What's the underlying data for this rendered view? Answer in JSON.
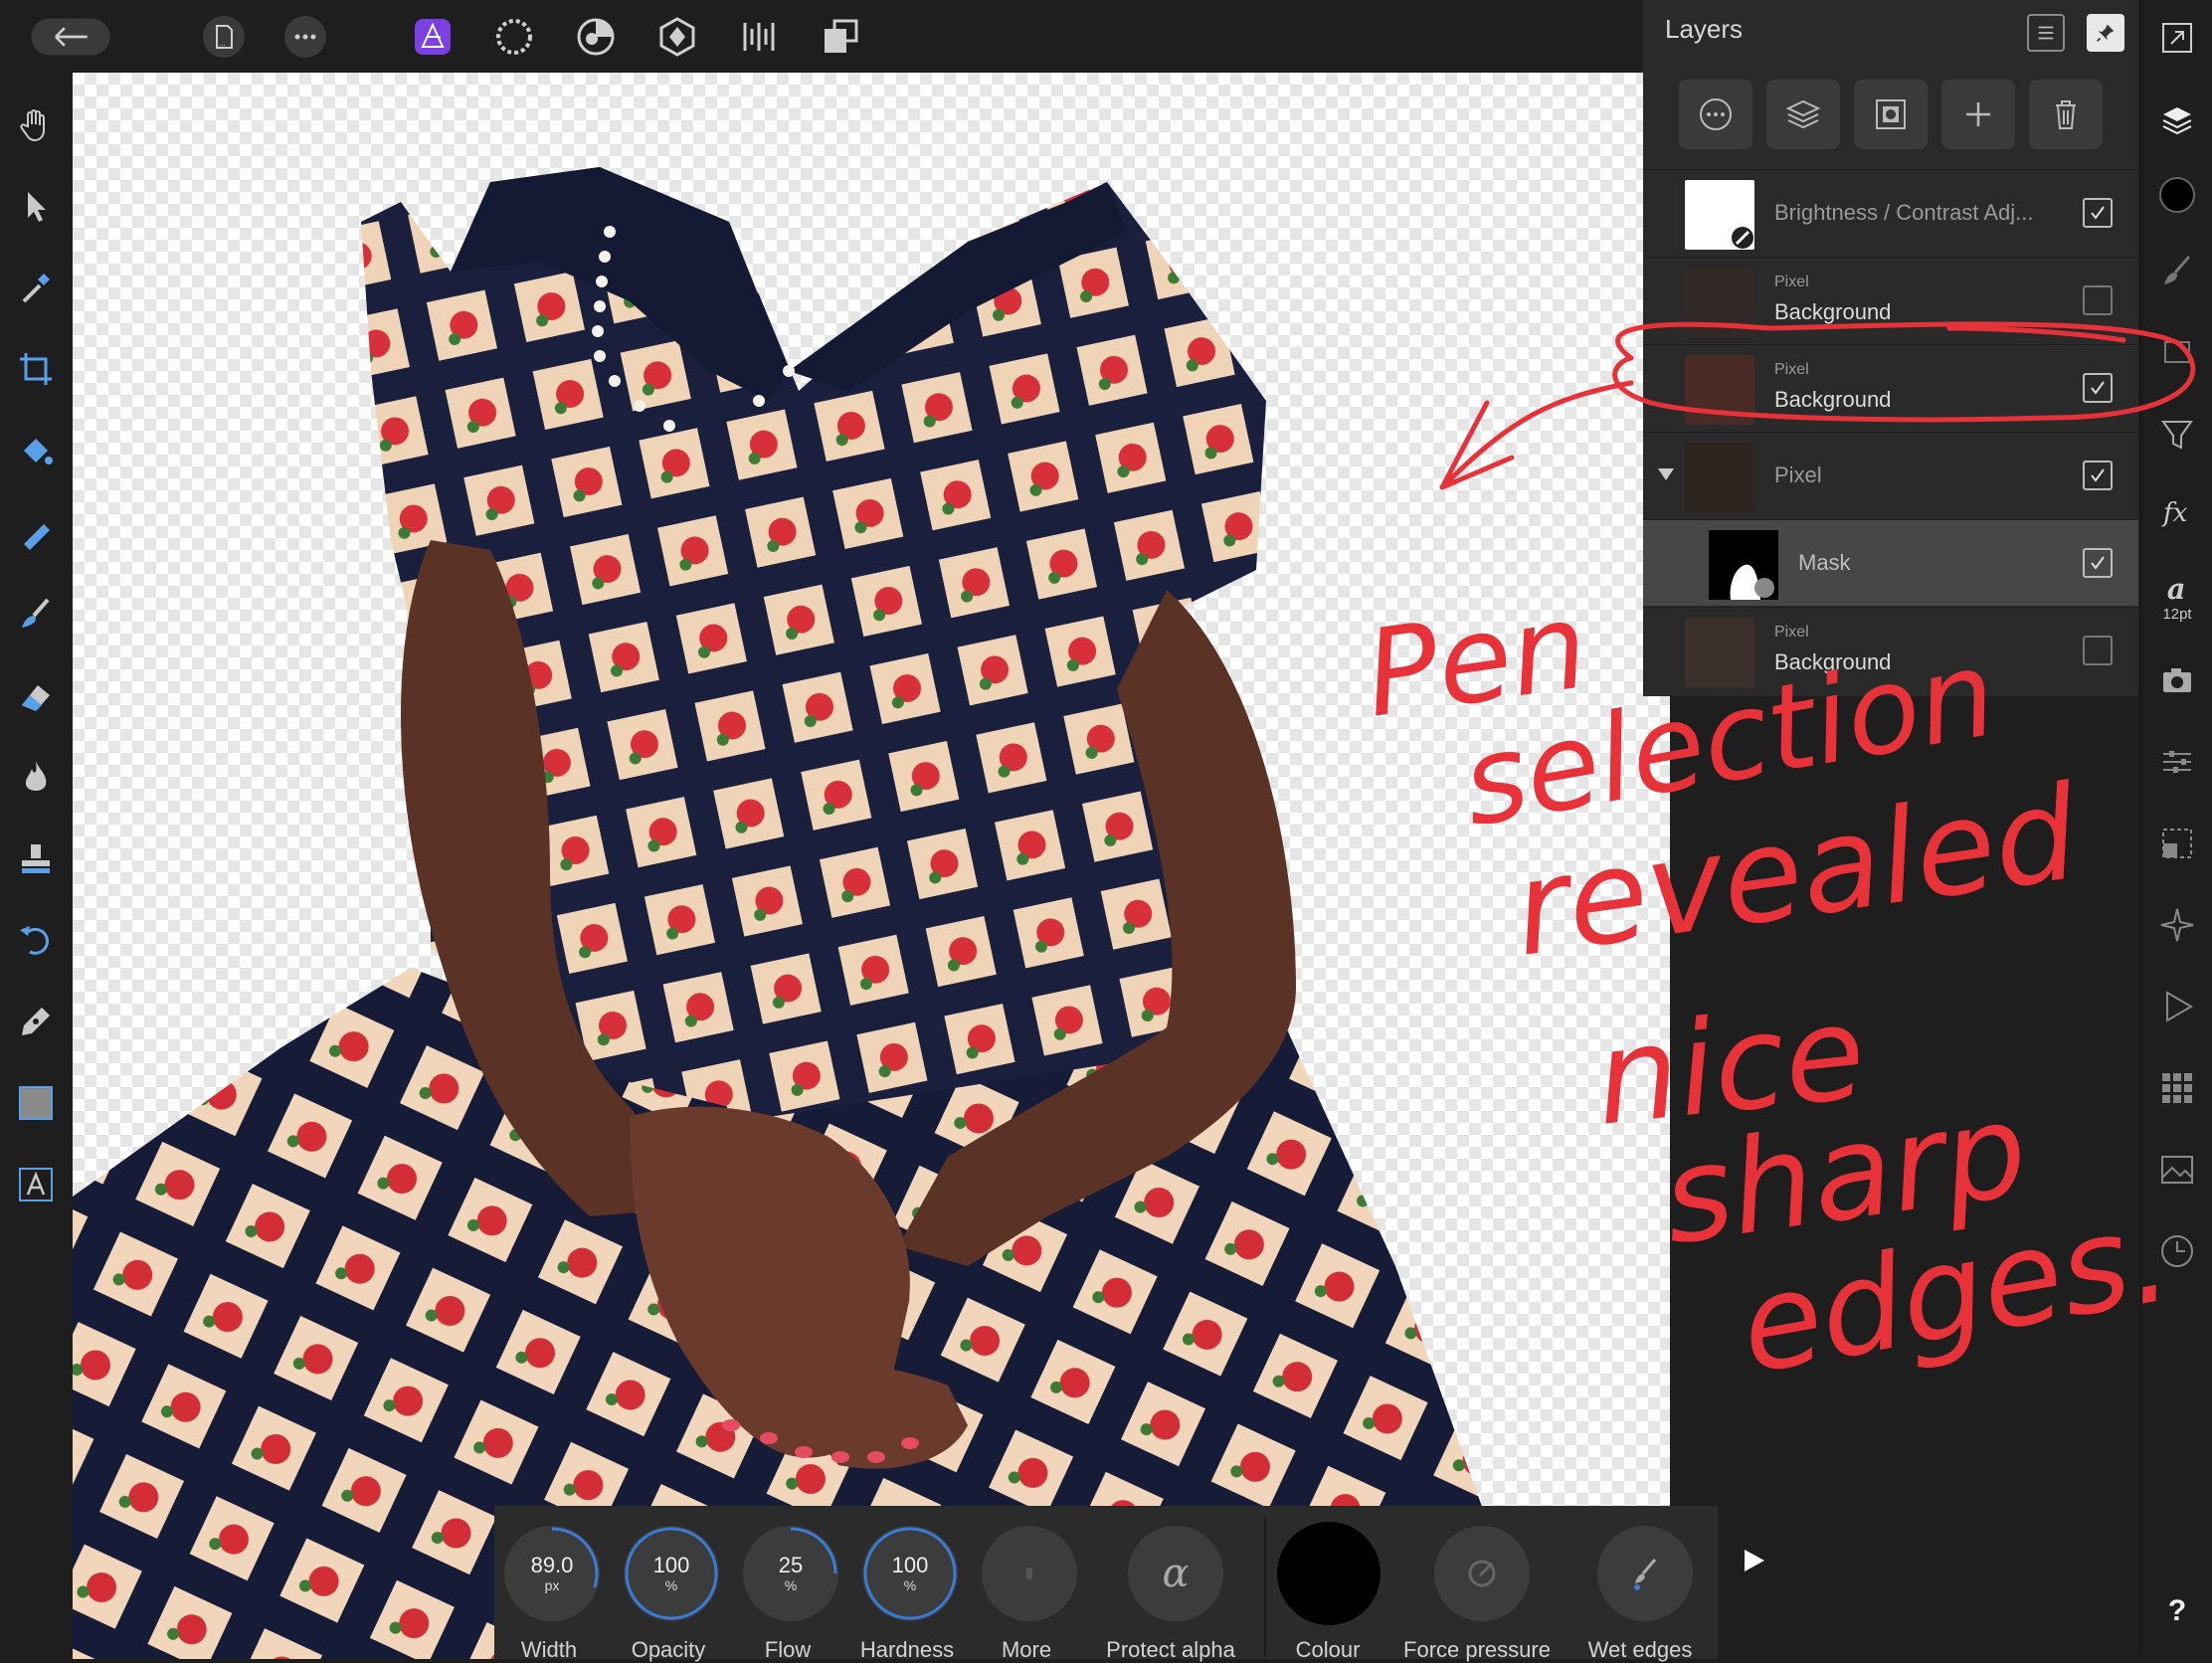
{
  "top_bar": {
    "icons": [
      "back-arrow-icon",
      "document-icon",
      "more-icon",
      "photo-persona-icon",
      "liquify-persona-icon",
      "develop-persona-icon",
      "tone-mapping-persona-icon",
      "export-persona-icon",
      "share-icon"
    ]
  },
  "left_tools": [
    "hand-icon",
    "move-icon",
    "color-picker-icon",
    "crop-icon",
    "flood-fill-icon",
    "selection-brush-icon",
    "paint-brush-icon",
    "erase-brush-icon",
    "burn-icon",
    "clone-stamp-icon",
    "undo-brush-icon",
    "pen-icon",
    "rectangle-icon",
    "text-icon"
  ],
  "layers": {
    "title": "Layers",
    "items": [
      {
        "kind": "",
        "name": "Brightness / Contrast Adj...",
        "checked": true
      },
      {
        "kind": "Pixel",
        "name": "Background",
        "checked": false
      },
      {
        "kind": "Pixel",
        "name": "Background",
        "checked": true
      },
      {
        "kind": "",
        "name": "Pixel",
        "checked": true
      },
      {
        "kind": "",
        "name": "Mask",
        "checked": true
      },
      {
        "kind": "Pixel",
        "name": "Background",
        "checked": false
      }
    ]
  },
  "right_strip": {
    "text_size": "12pt",
    "help": "?"
  },
  "context_bar": {
    "width": {
      "value": "89.0",
      "unit": "px",
      "label": "Width",
      "level": 0.3
    },
    "opacity": {
      "value": "100",
      "unit": "%",
      "label": "Opacity",
      "level": 1.0
    },
    "flow": {
      "value": "25",
      "unit": "%",
      "label": "Flow",
      "level": 0.25
    },
    "hardness": {
      "value": "100",
      "unit": "%",
      "label": "Hardness",
      "level": 1.0
    },
    "more": {
      "label": "More"
    },
    "protect_alpha": {
      "label": "Protect alpha",
      "glyph": "α"
    },
    "colour": {
      "label": "Colour",
      "value": "#000000"
    },
    "force_pressure": {
      "label": "Force pressure"
    },
    "wet_edges": {
      "label": "Wet edges"
    }
  },
  "colors": {
    "accent": "#3a7bd5",
    "annotation": "#e8323a"
  }
}
